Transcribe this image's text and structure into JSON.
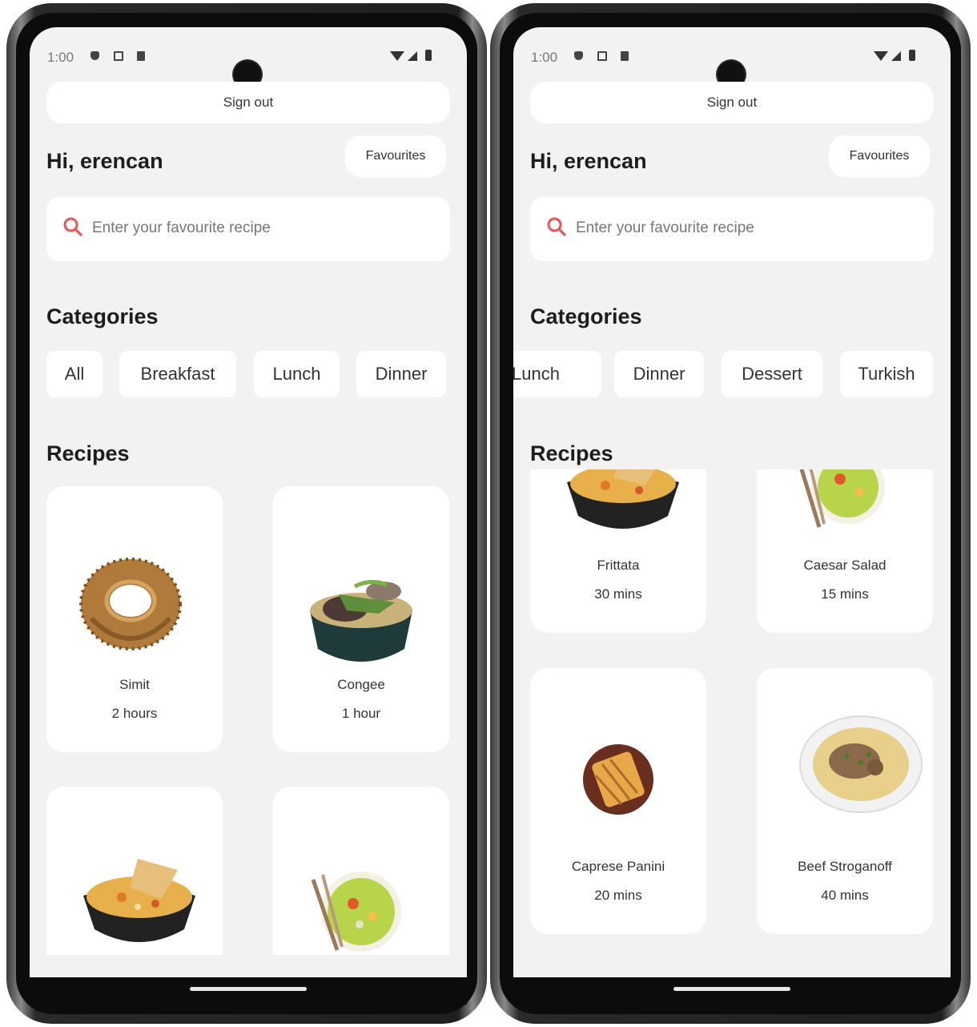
{
  "status": {
    "time": "1:00"
  },
  "header": {
    "signout_label": "Sign out",
    "greeting": "Hi, erencan",
    "favourites_label": "Favourites"
  },
  "search": {
    "placeholder": "Enter your favourite recipe",
    "icon": "search-icon"
  },
  "sections": {
    "categories_title": "Categories",
    "recipes_title": "Recipes"
  },
  "categories": [
    "All",
    "Breakfast",
    "Lunch",
    "Dinner",
    "Dessert",
    "Turkish"
  ],
  "recipes": [
    {
      "name": "Simit",
      "time": "2 hours"
    },
    {
      "name": "Congee",
      "time": "1 hour"
    },
    {
      "name": "Frittata",
      "time": "30 mins"
    },
    {
      "name": "Caesar Salad",
      "time": "15 mins"
    },
    {
      "name": "Caprese Panini",
      "time": "20 mins"
    },
    {
      "name": "Beef Stroganoff",
      "time": "40 mins"
    }
  ],
  "colors": {
    "accent": "#e4585b",
    "background": "#f2f2f2",
    "card": "#ffffff",
    "text": "#1d1d1d"
  }
}
